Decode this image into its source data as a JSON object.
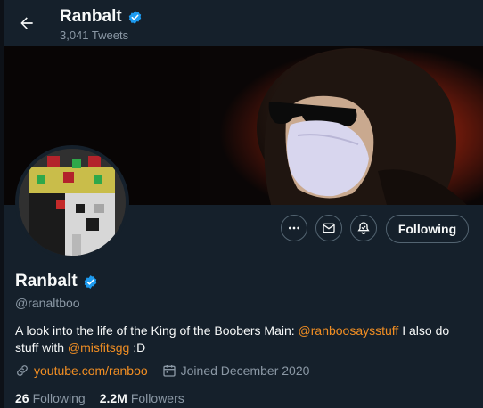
{
  "header": {
    "title": "Ranbalt",
    "tweet_count": "3,041 Tweets",
    "back_icon": "arrow-left-icon",
    "verified_icon": "verified-badge-icon"
  },
  "banner": {
    "description_icon": "profile-banner"
  },
  "profile": {
    "name": "Ranbalt",
    "handle": "@ranaltboo",
    "bio_text_1": "A look into the life of the King of the Boobers Main: ",
    "bio_mention_1": "@ranboosaysstuff",
    "bio_text_2": "  I also do stuff with ",
    "bio_mention_2": "@misfitsgg",
    "bio_text_3": " :D",
    "website": "youtube.com/ranboo",
    "joined": "Joined December 2020",
    "following_count": "26",
    "following_label": "Following",
    "followers_count": "2.2M",
    "followers_label": "Followers"
  },
  "actions": {
    "more_icon": "more-icon",
    "message_icon": "mail-icon",
    "notify_icon": "bell-plus-icon",
    "follow_label": "Following"
  },
  "colors": {
    "background": "#15202b",
    "accent": "#f18e23",
    "verified": "#1d9bf0",
    "secondary_text": "#8b98a5"
  }
}
